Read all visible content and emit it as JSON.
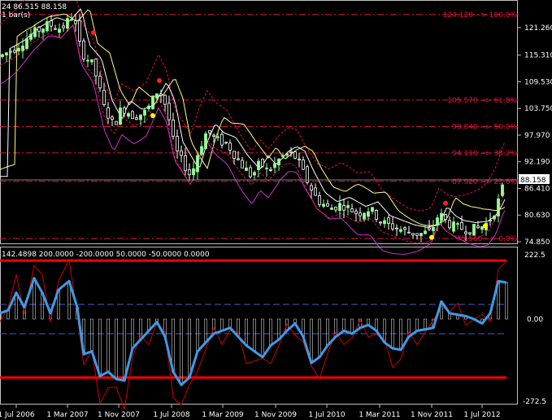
{
  "main_header": {
    "line1": "24 86.515 88.158",
    "line2": "1 bar(s)"
  },
  "price_scale": {
    "ticks": [
      "121.260",
      "115.310",
      "109.530",
      "103.750",
      "97.970",
      "92.190",
      "86.410",
      "80.630",
      "74.850"
    ],
    "current_price": "88.158"
  },
  "fibo_levels": [
    {
      "price": 124.12,
      "label": "124.120 --> 100.0%"
    },
    {
      "price": 105.57,
      "label": "105.570 --> 61.8%"
    },
    {
      "price": 99.84,
      "label": "99.840 --> 50.0%"
    },
    {
      "price": 94.11,
      "label": "94.110 --> 38.2%"
    },
    {
      "price": 87.92,
      "label": "87.920 --> 23.6%"
    },
    {
      "price": 75.56,
      "label": "75.560 --> 0.0%"
    }
  ],
  "indicator": {
    "header": "142.4898 200.0000 -200.0000 50.0000 -50.0000 0.0000",
    "ticks": [
      "222.5",
      "0.00",
      "-272.5"
    ]
  },
  "time_axis": {
    "labels": [
      "1 Jul 2006",
      "1 Mar 2007",
      "1 Nov 2007",
      "1 Jul 2008",
      "1 Mar 2009",
      "1 Nov 2009",
      "1 Jul 2010",
      "1 Mar 2011",
      "1 Nov 2011",
      "1 Jul 2012"
    ]
  },
  "colors": {
    "background": "#000000",
    "grid_frame": "#c0c0c0",
    "text": "#ffffff",
    "fibo": "#dc143c",
    "bull_candle": "#98fb98",
    "bear_candle": "#ffffff",
    "ma_yellow": "#ffff80",
    "channel_magenta": "#cc33cc",
    "cci": "#3c9be8",
    "fast_line": "#cc0000",
    "level_red": "#ff0000",
    "level_blue": "#4a5cc8"
  }
}
